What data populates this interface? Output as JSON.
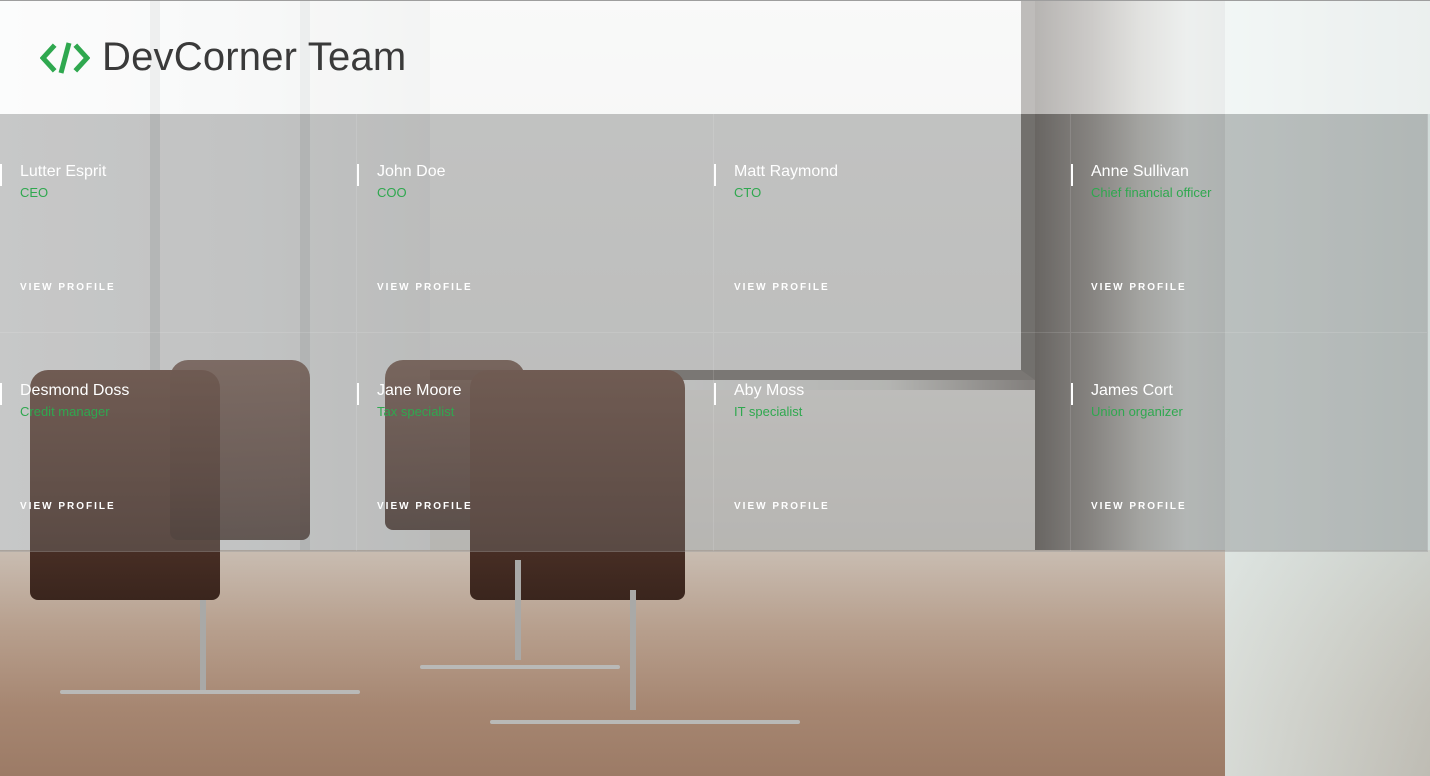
{
  "header": {
    "brand_title": "DevCorner Team",
    "logo_icon": "code-brackets-icon",
    "accent_color": "#2fa84f"
  },
  "team": [
    {
      "name": "Lutter Esprit",
      "role": "CEO",
      "link_label": "VIEW PROFILE"
    },
    {
      "name": "John Doe",
      "role": "COO",
      "link_label": "VIEW PROFILE"
    },
    {
      "name": "Matt Raymond",
      "role": "CTO",
      "link_label": "VIEW PROFILE"
    },
    {
      "name": "Anne Sullivan",
      "role": "Chief financial officer",
      "link_label": "VIEW PROFILE"
    },
    {
      "name": "Desmond Doss",
      "role": "Credit manager",
      "link_label": "VIEW PROFILE"
    },
    {
      "name": "Jane Moore",
      "role": "Tax specialist",
      "link_label": "VIEW PROFILE"
    },
    {
      "name": "Aby Moss",
      "role": "IT specialist",
      "link_label": "VIEW PROFILE"
    },
    {
      "name": "James Cort",
      "role": "Union organizer",
      "link_label": "VIEW PROFILE"
    }
  ]
}
